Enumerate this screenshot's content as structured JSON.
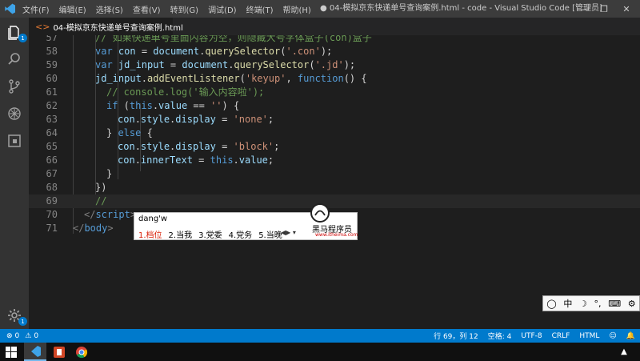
{
  "titlebar": {
    "menu": [
      "文件(F)",
      "编辑(E)",
      "选择(S)",
      "查看(V)",
      "转到(G)",
      "调试(D)",
      "终端(T)",
      "帮助(H)"
    ],
    "title": "● 04-模拟京东快递单号查询案例.html - code - Visual Studio Code [管理员]",
    "minimize": "—",
    "maximize": "❐",
    "close": "✕"
  },
  "activity": {
    "explorer_badge": "1",
    "settings_badge": "1"
  },
  "tab": {
    "label": "04-模拟京东快递单号查询案例.html"
  },
  "code": {
    "lines": [
      {
        "n": "57",
        "indent": 4,
        "tokens": [
          [
            "// 如果快递单号里面内容为空，则隐藏大号字体盒子(con)盒子",
            "c"
          ]
        ]
      },
      {
        "n": "58",
        "indent": 4,
        "tokens": [
          [
            "var ",
            "k"
          ],
          [
            "con",
            "v"
          ],
          [
            " = ",
            "p"
          ],
          [
            "document",
            "v"
          ],
          [
            ".",
            "p"
          ],
          [
            "querySelector",
            "f"
          ],
          [
            "(",
            "p"
          ],
          [
            "'.con'",
            "s"
          ],
          [
            ");",
            "p"
          ]
        ]
      },
      {
        "n": "59",
        "indent": 4,
        "tokens": [
          [
            "var ",
            "k"
          ],
          [
            "jd_input",
            "v"
          ],
          [
            " = ",
            "p"
          ],
          [
            "document",
            "v"
          ],
          [
            ".",
            "p"
          ],
          [
            "querySelector",
            "f"
          ],
          [
            "(",
            "p"
          ],
          [
            "'.jd'",
            "s"
          ],
          [
            ");",
            "p"
          ]
        ]
      },
      {
        "n": "60",
        "indent": 4,
        "tokens": [
          [
            "jd_input",
            "v"
          ],
          [
            ".",
            "p"
          ],
          [
            "addEventListener",
            "f"
          ],
          [
            "(",
            "p"
          ],
          [
            "'keyup'",
            "s"
          ],
          [
            ", ",
            "p"
          ],
          [
            "function",
            "k"
          ],
          [
            "() {",
            "p"
          ]
        ]
      },
      {
        "n": "61",
        "indent": 6,
        "tokens": [
          [
            "// console.log('输入内容啦');",
            "c"
          ]
        ]
      },
      {
        "n": "62",
        "indent": 6,
        "tokens": [
          [
            "if",
            "k"
          ],
          [
            " (",
            "p"
          ],
          [
            "this",
            "k"
          ],
          [
            ".",
            "p"
          ],
          [
            "value",
            "v"
          ],
          [
            " == ",
            "p"
          ],
          [
            "''",
            "s"
          ],
          [
            ") {",
            "p"
          ]
        ]
      },
      {
        "n": "63",
        "indent": 8,
        "tokens": [
          [
            "con",
            "v"
          ],
          [
            ".",
            "p"
          ],
          [
            "style",
            "v"
          ],
          [
            ".",
            "p"
          ],
          [
            "display",
            "v"
          ],
          [
            " = ",
            "p"
          ],
          [
            "'none'",
            "s"
          ],
          [
            ";",
            "p"
          ]
        ]
      },
      {
        "n": "64",
        "indent": 6,
        "tokens": [
          [
            "} ",
            "p"
          ],
          [
            "else",
            "k"
          ],
          [
            " {",
            "p"
          ]
        ]
      },
      {
        "n": "65",
        "indent": 8,
        "tokens": [
          [
            "con",
            "v"
          ],
          [
            ".",
            "p"
          ],
          [
            "style",
            "v"
          ],
          [
            ".",
            "p"
          ],
          [
            "display",
            "v"
          ],
          [
            " = ",
            "p"
          ],
          [
            "'block'",
            "s"
          ],
          [
            ";",
            "p"
          ]
        ]
      },
      {
        "n": "66",
        "indent": 8,
        "tokens": [
          [
            "con",
            "v"
          ],
          [
            ".",
            "p"
          ],
          [
            "innerText",
            "v"
          ],
          [
            " = ",
            "p"
          ],
          [
            "this",
            "k"
          ],
          [
            ".",
            "p"
          ],
          [
            "value",
            "v"
          ],
          [
            ";",
            "p"
          ]
        ]
      },
      {
        "n": "67",
        "indent": 6,
        "tokens": [
          [
            "}",
            "p"
          ]
        ]
      },
      {
        "n": "68",
        "indent": 4,
        "tokens": [
          [
            "})",
            "p"
          ]
        ]
      },
      {
        "n": "69",
        "indent": 4,
        "tokens": [
          [
            "//",
            "c"
          ]
        ]
      },
      {
        "n": "70",
        "indent": 2,
        "tokens": [
          [
            "</",
            "t"
          ],
          [
            "script",
            "tg"
          ],
          [
            ">",
            "t"
          ]
        ]
      },
      {
        "n": "71",
        "indent": 0,
        "tokens": [
          [
            "</",
            "t"
          ],
          [
            "body",
            "tg"
          ],
          [
            ">",
            "t"
          ]
        ]
      }
    ],
    "current_line": "69"
  },
  "ime": {
    "input": "dang'w",
    "candidates": [
      "1.档位",
      "2.当我",
      "3.党委",
      "4.党务",
      "5.当晚"
    ],
    "brand": "黑马程序员",
    "site": "www.itheima.com"
  },
  "imebar": {
    "lang": "中",
    "moon": "☽",
    "punct": "°,"
  },
  "statusbar": {
    "errors": "0",
    "warnings": "0",
    "position": "行 69，列 12",
    "spaces": "空格: 4",
    "encoding": "UTF-8",
    "eol": "CRLF",
    "language": "HTML"
  },
  "colors": {
    "accent": "#007acc",
    "editor_bg": "#1e1e1e",
    "titlebar_bg": "#3c3c3c"
  }
}
